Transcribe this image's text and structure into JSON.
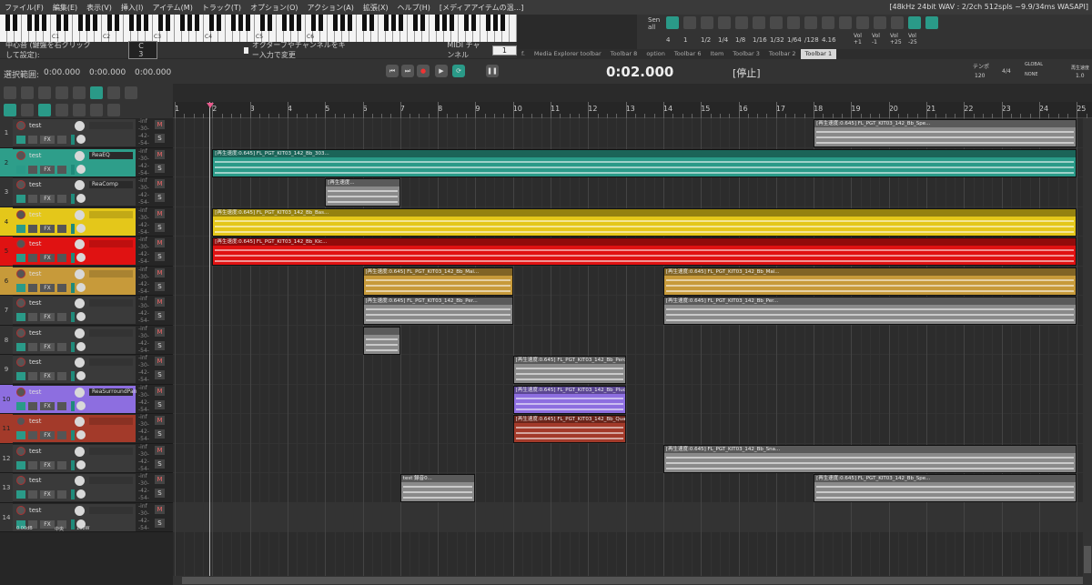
{
  "menu": [
    "ファイル(F)",
    "編集(E)",
    "表示(V)",
    "挿入(I)",
    "アイテム(M)",
    "トラック(T)",
    "オプション(O)",
    "アクション(A)",
    "拡張(X)",
    "ヘルプ(H)",
    "[メディアアイテムの温...]"
  ],
  "status": "[48kHz 24bit WAV : 2/2ch 512spls ~9.9/34ms WASAPI]",
  "piano": {
    "labels": [
      "C1",
      "C2",
      "C3",
      "C4",
      "C5",
      "C6"
    ]
  },
  "kb": {
    "center_label": "中心音 (鍵盤を右クリックして設定):",
    "center_value": "C 3",
    "octave_label": "オクターブやチャンネルをキー入力で変更",
    "midi_label": "MIDI チャンネル",
    "midi_value": "1"
  },
  "toolbar": {
    "send_all": "Sen all",
    "grid_values": [
      "4",
      "1",
      "1/2",
      "1/4",
      "1/8",
      "1/16",
      "1/32",
      "1/64",
      "/128",
      "4.16"
    ],
    "vol_labels": [
      "Vol +1",
      "Vol -1",
      "Vol +25",
      "Vol -25"
    ]
  },
  "tabs": [
    "Media Explorer toolbar",
    "Toolbar 8",
    "option",
    "Toolbar 6",
    "Item",
    "Toolbar 3",
    "Toolbar 2",
    "Toolbar 1"
  ],
  "tabs_active": "Toolbar 1",
  "transport": {
    "sel_label": "選択範囲:",
    "sel_values": [
      "0:00.000",
      "0:00.000",
      "0:00.000"
    ],
    "time": "0:02.000",
    "state": "[停止]",
    "tempo_label": "テンポ",
    "tempo": "120",
    "sig": "4/4",
    "global": "GLOBAL",
    "none": "NONE",
    "rate": "再生速度",
    "rate_val": "1.0"
  },
  "ruler": [
    "1",
    "2",
    "3",
    "4",
    "5",
    "6",
    "7",
    "8",
    "9",
    "10",
    "11",
    "12",
    "13",
    "14",
    "15",
    "16",
    "17",
    "18",
    "19",
    "20",
    "21",
    "22",
    "23",
    "24",
    "25"
  ],
  "tracks": [
    {
      "num": "1",
      "name": "test",
      "color": "#3a3a3a",
      "fx": ""
    },
    {
      "num": "2",
      "name": "test",
      "color": "#2e9e8a",
      "fx": "ReaEQ"
    },
    {
      "num": "3",
      "name": "test",
      "color": "#3a3a3a",
      "fx": "ReaComp"
    },
    {
      "num": "4",
      "name": "test",
      "color": "#e4c71a",
      "fx": ""
    },
    {
      "num": "5",
      "name": "test",
      "color": "#e01212",
      "fx": ""
    },
    {
      "num": "6",
      "name": "test",
      "color": "#c79a3a",
      "fx": ""
    },
    {
      "num": "7",
      "name": "test",
      "color": "#3a3a3a",
      "fx": ""
    },
    {
      "num": "8",
      "name": "test",
      "color": "#3a3a3a",
      "fx": ""
    },
    {
      "num": "9",
      "name": "test",
      "color": "#3a3a3a",
      "fx": ""
    },
    {
      "num": "10",
      "name": "test",
      "color": "#8d6ee0",
      "fx": "ReaSurroundPan"
    },
    {
      "num": "11",
      "name": "test",
      "color": "#a33a2a",
      "fx": ""
    },
    {
      "num": "12",
      "name": "test",
      "color": "#3a3a3a",
      "fx": ""
    },
    {
      "num": "13",
      "name": "test",
      "color": "#3a3a3a",
      "fx": ""
    },
    {
      "num": "14",
      "name": "test",
      "color": "#3a3a3a",
      "fx": ""
    }
  ],
  "meter_labels": [
    "-inf",
    "-30-",
    "-42-",
    "-54-"
  ],
  "master": {
    "vol": "0.00dB",
    "pan": "中央",
    "width": "100W"
  },
  "items": [
    {
      "track": 0,
      "start": 18,
      "end": 25,
      "color": "#8a8a8a",
      "label": "[再生速度:0.645] FL_PGT_KIT03_142_Bb_Spe..."
    },
    {
      "track": 1,
      "start": 2,
      "end": 25,
      "color": "#2a9a88",
      "label": "[再生速度:0.645] FL_PGT_KIT03_142_Bb_303..."
    },
    {
      "track": 2,
      "start": 5,
      "end": 7,
      "color": "#8a8a8a",
      "label": "[再生速度..."
    },
    {
      "track": 3,
      "start": 2,
      "end": 25,
      "color": "#e4c71a",
      "label": "[再生速度:0.645] FL_PGT_KIT03_142_Bb_Bas..."
    },
    {
      "track": 4,
      "start": 2,
      "end": 25,
      "color": "#e01212",
      "label": "[再生速度:0.645] FL_PGT_KIT03_142_Bb_Kic..."
    },
    {
      "track": 5,
      "start": 6,
      "end": 10,
      "color": "#c79a3a",
      "label": "[再生速度:0.645] FL_PGT_KIT03_142_Bb_Mai..."
    },
    {
      "track": 5,
      "start": 14,
      "end": 25,
      "color": "#c79a3a",
      "label": "[再生速度:0.645] FL_PGT_KIT03_142_Bb_Mai..."
    },
    {
      "track": 6,
      "start": 6,
      "end": 10,
      "color": "#8a8a8a",
      "label": "[再生速度:0.645] FL_PGT_KIT03_142_Bb_Per..."
    },
    {
      "track": 6,
      "start": 14,
      "end": 25,
      "color": "#8a8a8a",
      "label": "[再生速度:0.645] FL_PGT_KIT03_142_Bb_Per..."
    },
    {
      "track": 7,
      "start": 6,
      "end": 7,
      "color": "#8a8a8a",
      "label": ""
    },
    {
      "track": 8,
      "start": 10,
      "end": 13,
      "color": "#8a8a8a",
      "label": "[再生速度:0.645] FL_PGT_KIT03_142_Bb_Perc..."
    },
    {
      "track": 9,
      "start": 10,
      "end": 13,
      "color": "#8d6ee0",
      "label": "[再生速度:0.645] FL_PGT_KIT03_142_Bb_Pluc..."
    },
    {
      "track": 10,
      "start": 10,
      "end": 13,
      "color": "#a33a2a",
      "label": "[再生速度:0.645] FL_PGT_KIT03_142_Bb_Qua..."
    },
    {
      "track": 11,
      "start": 14,
      "end": 25,
      "color": "#8a8a8a",
      "label": "[再生速度:0.645] FL_PGT_KIT03_142_Bb_Sna..."
    },
    {
      "track": 12,
      "start": 7,
      "end": 9,
      "color": "#8a8a8a",
      "label": "test 録音0..."
    },
    {
      "track": 12,
      "start": 18,
      "end": 25,
      "color": "#8a8a8a",
      "label": "[再生速度:0.645] FL_PGT_KIT03_142_Bb_Spe..."
    }
  ]
}
